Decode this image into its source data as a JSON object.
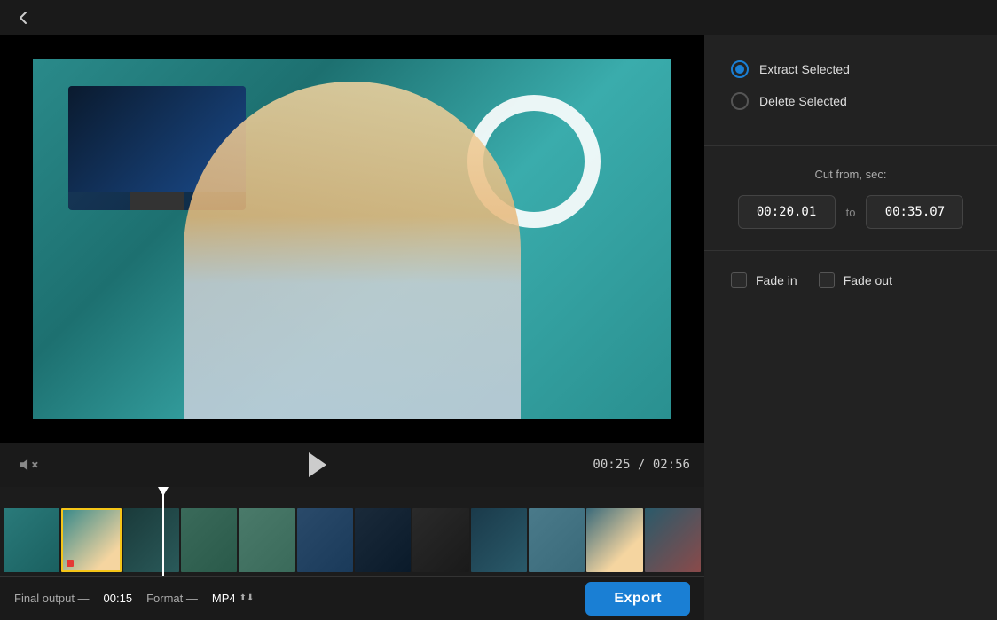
{
  "topbar": {
    "back_icon": "←"
  },
  "video": {
    "current_time": "00:25",
    "total_time": "02:56"
  },
  "controls": {
    "mute_icon": "🔇",
    "play_icon": "▶"
  },
  "right_panel": {
    "extract_selected_label": "Extract Selected",
    "delete_selected_label": "Delete Selected",
    "cut_from_label": "Cut from, sec:",
    "to_label": "to",
    "start_time": "00:20.01",
    "end_time": "00:35.07",
    "fade_in_label": "Fade in",
    "fade_out_label": "Fade out"
  },
  "bottom_bar": {
    "final_output_label": "Final output —",
    "final_output_value": "00:15",
    "format_label": "Format —",
    "format_value": "MP4",
    "export_label": "Export"
  }
}
